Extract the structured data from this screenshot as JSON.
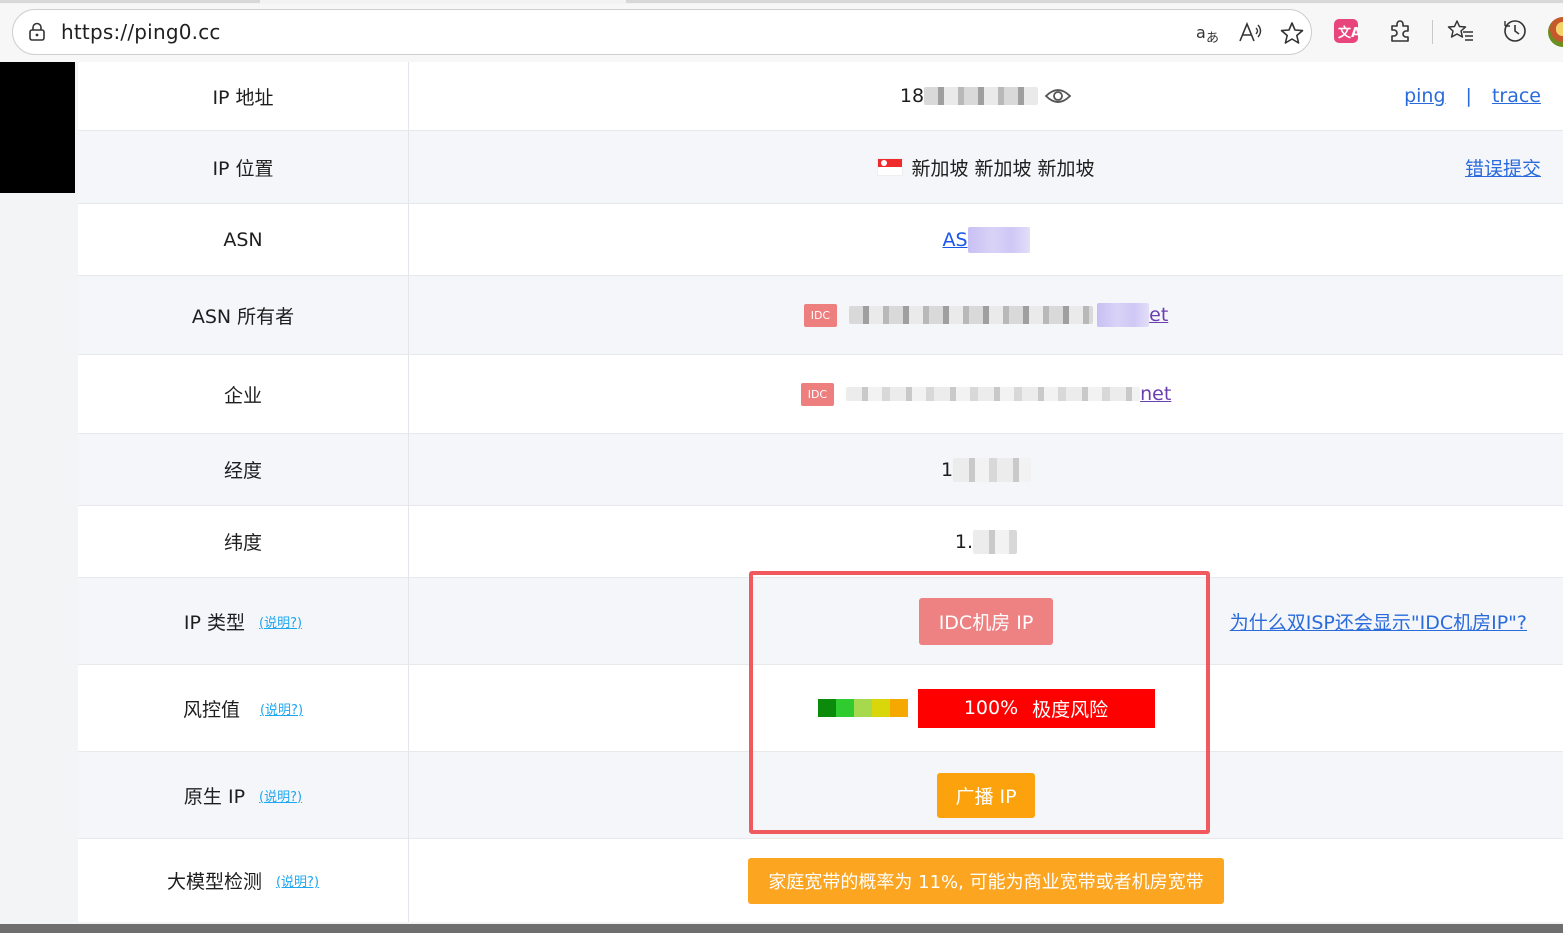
{
  "browser": {
    "url": "https://ping0.cc",
    "icons": [
      "lock-icon",
      "translate-icon",
      "read-aloud-icon",
      "favorite-star-icon",
      "extension-translate-icon",
      "extensions-puzzle-icon",
      "favorites-list-icon",
      "history-icon",
      "profile-avatar"
    ]
  },
  "rows": {
    "ip_address": {
      "label": "IP 地址",
      "value_prefix": "18",
      "link_ping": "ping",
      "link_sep": "|",
      "link_trace": "trace"
    },
    "ip_location": {
      "label": "IP 位置",
      "value": "新加坡 新加坡 新加坡",
      "report_link": "错误提交"
    },
    "asn": {
      "label": "ASN",
      "value_prefix": "AS"
    },
    "asn_owner": {
      "label": "ASN 所有者",
      "tag": "IDC",
      "value_suffix": "et"
    },
    "company": {
      "label": "企业",
      "tag": "IDC",
      "value_suffix": "net"
    },
    "longitude": {
      "label": "经度",
      "value_prefix": "1"
    },
    "latitude": {
      "label": "纬度",
      "value_prefix": "1."
    },
    "ip_type": {
      "label": "IP 类型",
      "help": "(说明?)",
      "badge": "IDC机房 IP",
      "side_link": "为什么双ISP还会显示\"IDC机房IP\"?"
    },
    "risk": {
      "label": "风控值",
      "help": "(说明?)",
      "percent": "100%",
      "level": "极度风险",
      "scale_colors": [
        "#0b8a0b",
        "#2fcb2f",
        "#a7d94f",
        "#d9d60b",
        "#f5a900"
      ]
    },
    "native_ip": {
      "label": "原生 IP",
      "help": "(说明?)",
      "badge": "广播 IP"
    },
    "llm_detect": {
      "label": "大模型检测",
      "help": "(说明?)",
      "badge": "家庭宽带的概率为 11%, 可能为商业宽带或者机房宽带"
    }
  },
  "colors": {
    "idc_tag": "#ee7f7f",
    "risk_red": "#ff0000",
    "broadcast_orange": "#fba20c",
    "highlight_box": "#f0595d",
    "link": "#2a6bdc"
  }
}
